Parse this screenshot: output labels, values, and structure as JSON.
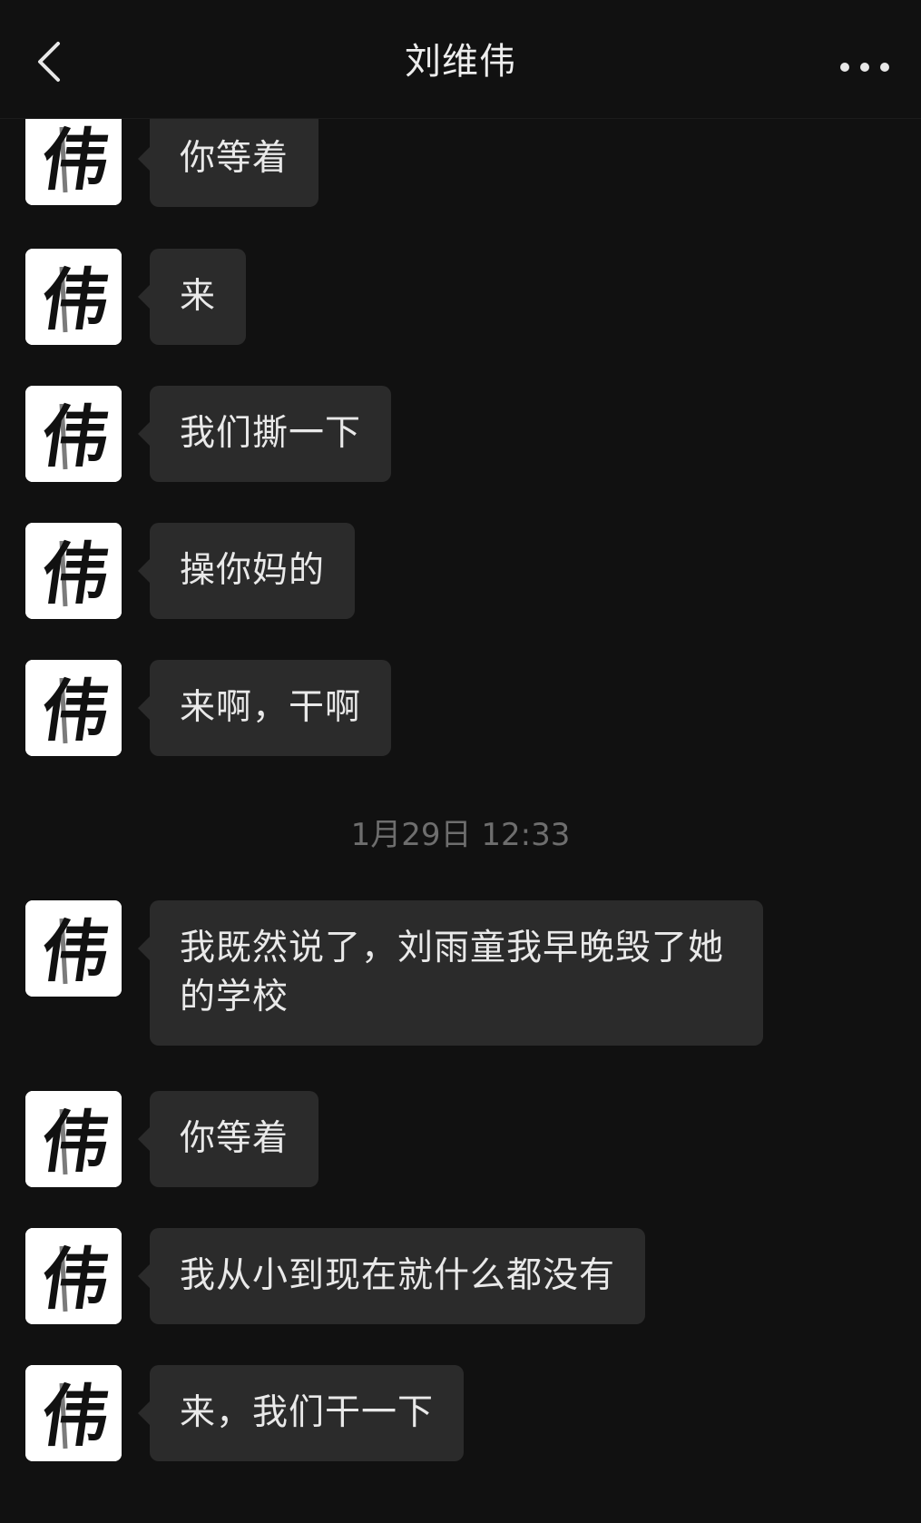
{
  "header": {
    "title": "刘维伟",
    "back_icon": "chevron-left-icon",
    "more_icon": "ellipsis-icon"
  },
  "avatar": {
    "glyph": "伟"
  },
  "messages_before": [
    {
      "text": "你等着"
    },
    {
      "text": "来"
    },
    {
      "text": "我们撕一下"
    },
    {
      "text": "操你妈的"
    },
    {
      "text": "来啊，干啊"
    }
  ],
  "timestamp": "1月29日 12:33",
  "messages_after": [
    {
      "text": "我既然说了，刘雨童我早晚毁了她的学校"
    },
    {
      "text": "你等着"
    },
    {
      "text": "我从小到现在就什么都没有"
    },
    {
      "text": "来，我们干一下"
    }
  ],
  "colors": {
    "background": "#111111",
    "bubble": "#2b2b2b",
    "text": "#e9e9e9",
    "timestamp": "#6e6e6e"
  }
}
